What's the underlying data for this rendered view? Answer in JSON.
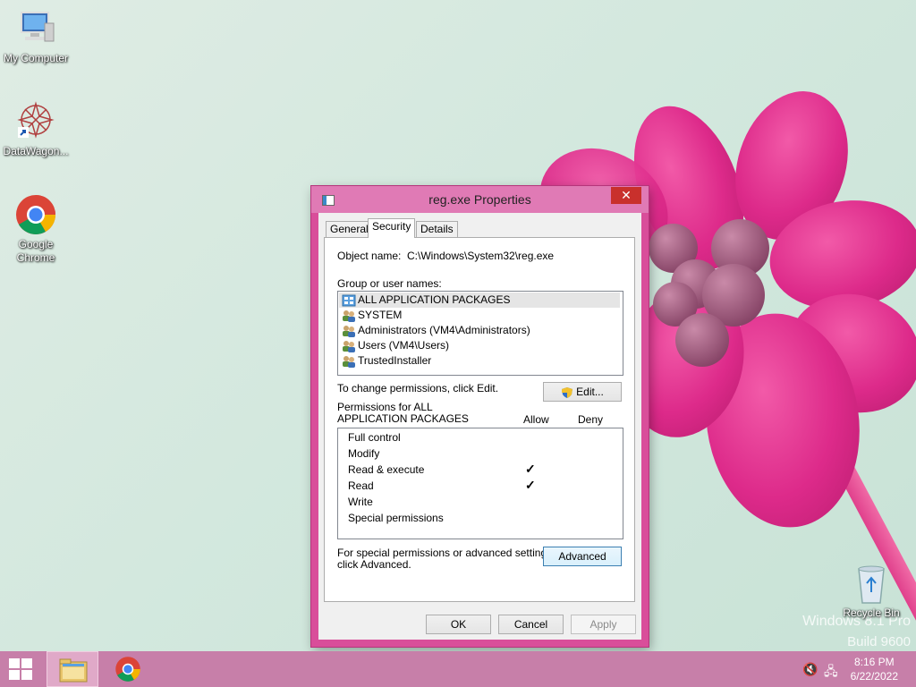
{
  "desktop": {
    "icons": [
      {
        "label": "My Computer"
      },
      {
        "label": "DataWagon..."
      },
      {
        "label": "Google Chrome"
      },
      {
        "label": "Recycle Bin"
      }
    ],
    "watermark_line1": "Windows 8.1 Pro",
    "watermark_line2": "Build 9600"
  },
  "dialog": {
    "title": "reg.exe Properties",
    "close_glyph": "✕",
    "tabs": [
      "General",
      "Security",
      "Details"
    ],
    "active_tab": "Security",
    "object_name_label": "Object name:",
    "object_name_value": "C:\\Windows\\System32\\reg.exe",
    "group_label": "Group or user names:",
    "groups": [
      "ALL APPLICATION PACKAGES",
      "SYSTEM",
      "Administrators (VM4\\Administrators)",
      "Users (VM4\\Users)",
      "TrustedInstaller"
    ],
    "selected_group": "ALL APPLICATION PACKAGES",
    "change_text": "To change permissions, click Edit.",
    "edit_button": "Edit...",
    "permissions_label_line1": "Permissions for ALL",
    "permissions_label_line2": "APPLICATION PACKAGES",
    "allow_header": "Allow",
    "deny_header": "Deny",
    "permissions": [
      {
        "name": "Full control",
        "allow": false,
        "deny": false
      },
      {
        "name": "Modify",
        "allow": false,
        "deny": false
      },
      {
        "name": "Read & execute",
        "allow": true,
        "deny": false
      },
      {
        "name": "Read",
        "allow": true,
        "deny": false
      },
      {
        "name": "Write",
        "allow": false,
        "deny": false
      },
      {
        "name": "Special permissions",
        "allow": false,
        "deny": false
      }
    ],
    "check_glyph": "✓",
    "advanced_text_line1": "For special permissions or advanced settings,",
    "advanced_text_line2": "click Advanced.",
    "advanced_button": "Advanced",
    "ok_button": "OK",
    "cancel_button": "Cancel",
    "apply_button": "Apply"
  },
  "taskbar": {
    "time": "8:16 PM",
    "date": "6/22/2022",
    "volume_glyph": "🔇",
    "network_glyph": "🖧"
  },
  "colors": {
    "dialog_frame": "#d94e9a",
    "taskbar": "#c77fa9",
    "focus_border": "#3c7fb1"
  }
}
